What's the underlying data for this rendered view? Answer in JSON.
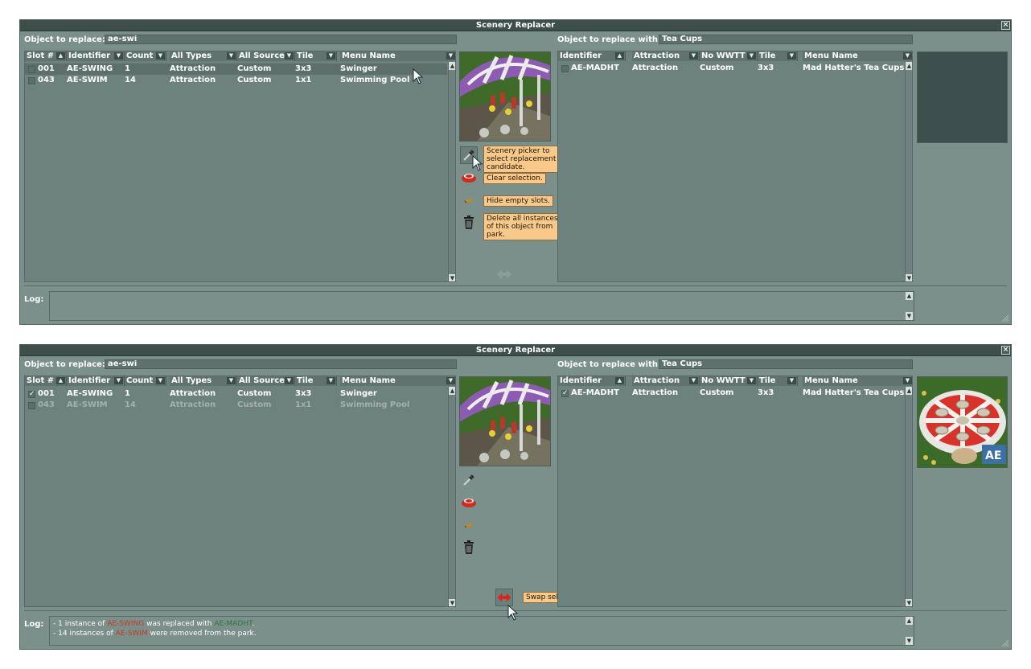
{
  "window_title": "Scenery Replacer",
  "close_glyph": "×",
  "labels": {
    "object_to_replace": "Object to replace:",
    "object_to_replace_with": "Object to replace with:",
    "log": "Log:"
  },
  "left_columns": [
    "Slot #",
    "Identifier",
    "Count",
    "All Types",
    "All Sources",
    "Tile",
    "Menu Name"
  ],
  "right_columns": [
    "Identifier",
    "Attraction",
    "No WWTT",
    "Tile",
    "Menu Name"
  ],
  "tooltips": {
    "picker": "Scenery picker to select replacement candidate.",
    "clear": "Clear selection.",
    "hide": "Hide empty slots.",
    "delete": "Delete all instances of this object from park.",
    "swap": "Swap selected objects."
  },
  "icons": {
    "picker": "eyedropper-icon",
    "clear": "eraser-icon",
    "hide": "hide-slots-icon",
    "delete": "trash-icon",
    "swap": "swap-arrows-icon",
    "sort": "sort-arrow-icon",
    "cursor": "mouse-cursor-icon"
  },
  "colors": {
    "panel": "#7b8f8b",
    "titlebar": "#3d4e4b",
    "tooltip": "#f8c98a",
    "log_red": "#c23b2a",
    "log_green": "#2e7a3a"
  },
  "panels": [
    {
      "search_value": "ae-swi",
      "replace_with_value": "Tea Cups",
      "left_rows": [
        {
          "check": "",
          "slot": "001",
          "identifier": "AE-SWING",
          "count": "1",
          "type": "Attraction",
          "source": "Custom",
          "tile": "3x3",
          "menu": "Swinger"
        },
        {
          "check": "",
          "slot": "043",
          "identifier": "AE-SWIM",
          "count": "14",
          "type": "Attraction",
          "source": "Custom",
          "tile": "1x1",
          "menu": "Swimming Pool"
        }
      ],
      "right_rows": [
        {
          "check": "",
          "identifier": "AE-MADHT",
          "type": "Attraction",
          "source": "Custom",
          "tile": "3x3",
          "menu": "Mad Hatter's Tea Cups"
        }
      ],
      "log_lines": []
    },
    {
      "search_value": "ae-swi",
      "replace_with_value": "Tea Cups",
      "left_rows": [
        {
          "check": "✓",
          "slot": "001",
          "identifier": "AE-SWING",
          "count": "1",
          "type": "Attraction",
          "source": "Custom",
          "tile": "3x3",
          "menu": "Swinger"
        },
        {
          "check": "",
          "slot": "043",
          "identifier": "AE-SWIM",
          "count": "14",
          "type": "Attraction",
          "source": "Custom",
          "tile": "1x1",
          "menu": "Swimming Pool"
        }
      ],
      "right_rows": [
        {
          "check": "✓",
          "identifier": "AE-MADHT",
          "type": "Attraction",
          "source": "Custom",
          "tile": "3x3",
          "menu": "Mad Hatter's Tea Cups"
        }
      ],
      "log_lines": [
        {
          "pre": "- 1 instance of ",
          "obj1": "AE-SWING",
          "mid": " was replaced with ",
          "obj2": "AE-MADHT",
          "post": "."
        },
        {
          "pre": "- 14 instances of ",
          "obj1": "AE-SWIM",
          "mid": " were removed from the park.",
          "obj2": "",
          "post": ""
        }
      ]
    }
  ]
}
